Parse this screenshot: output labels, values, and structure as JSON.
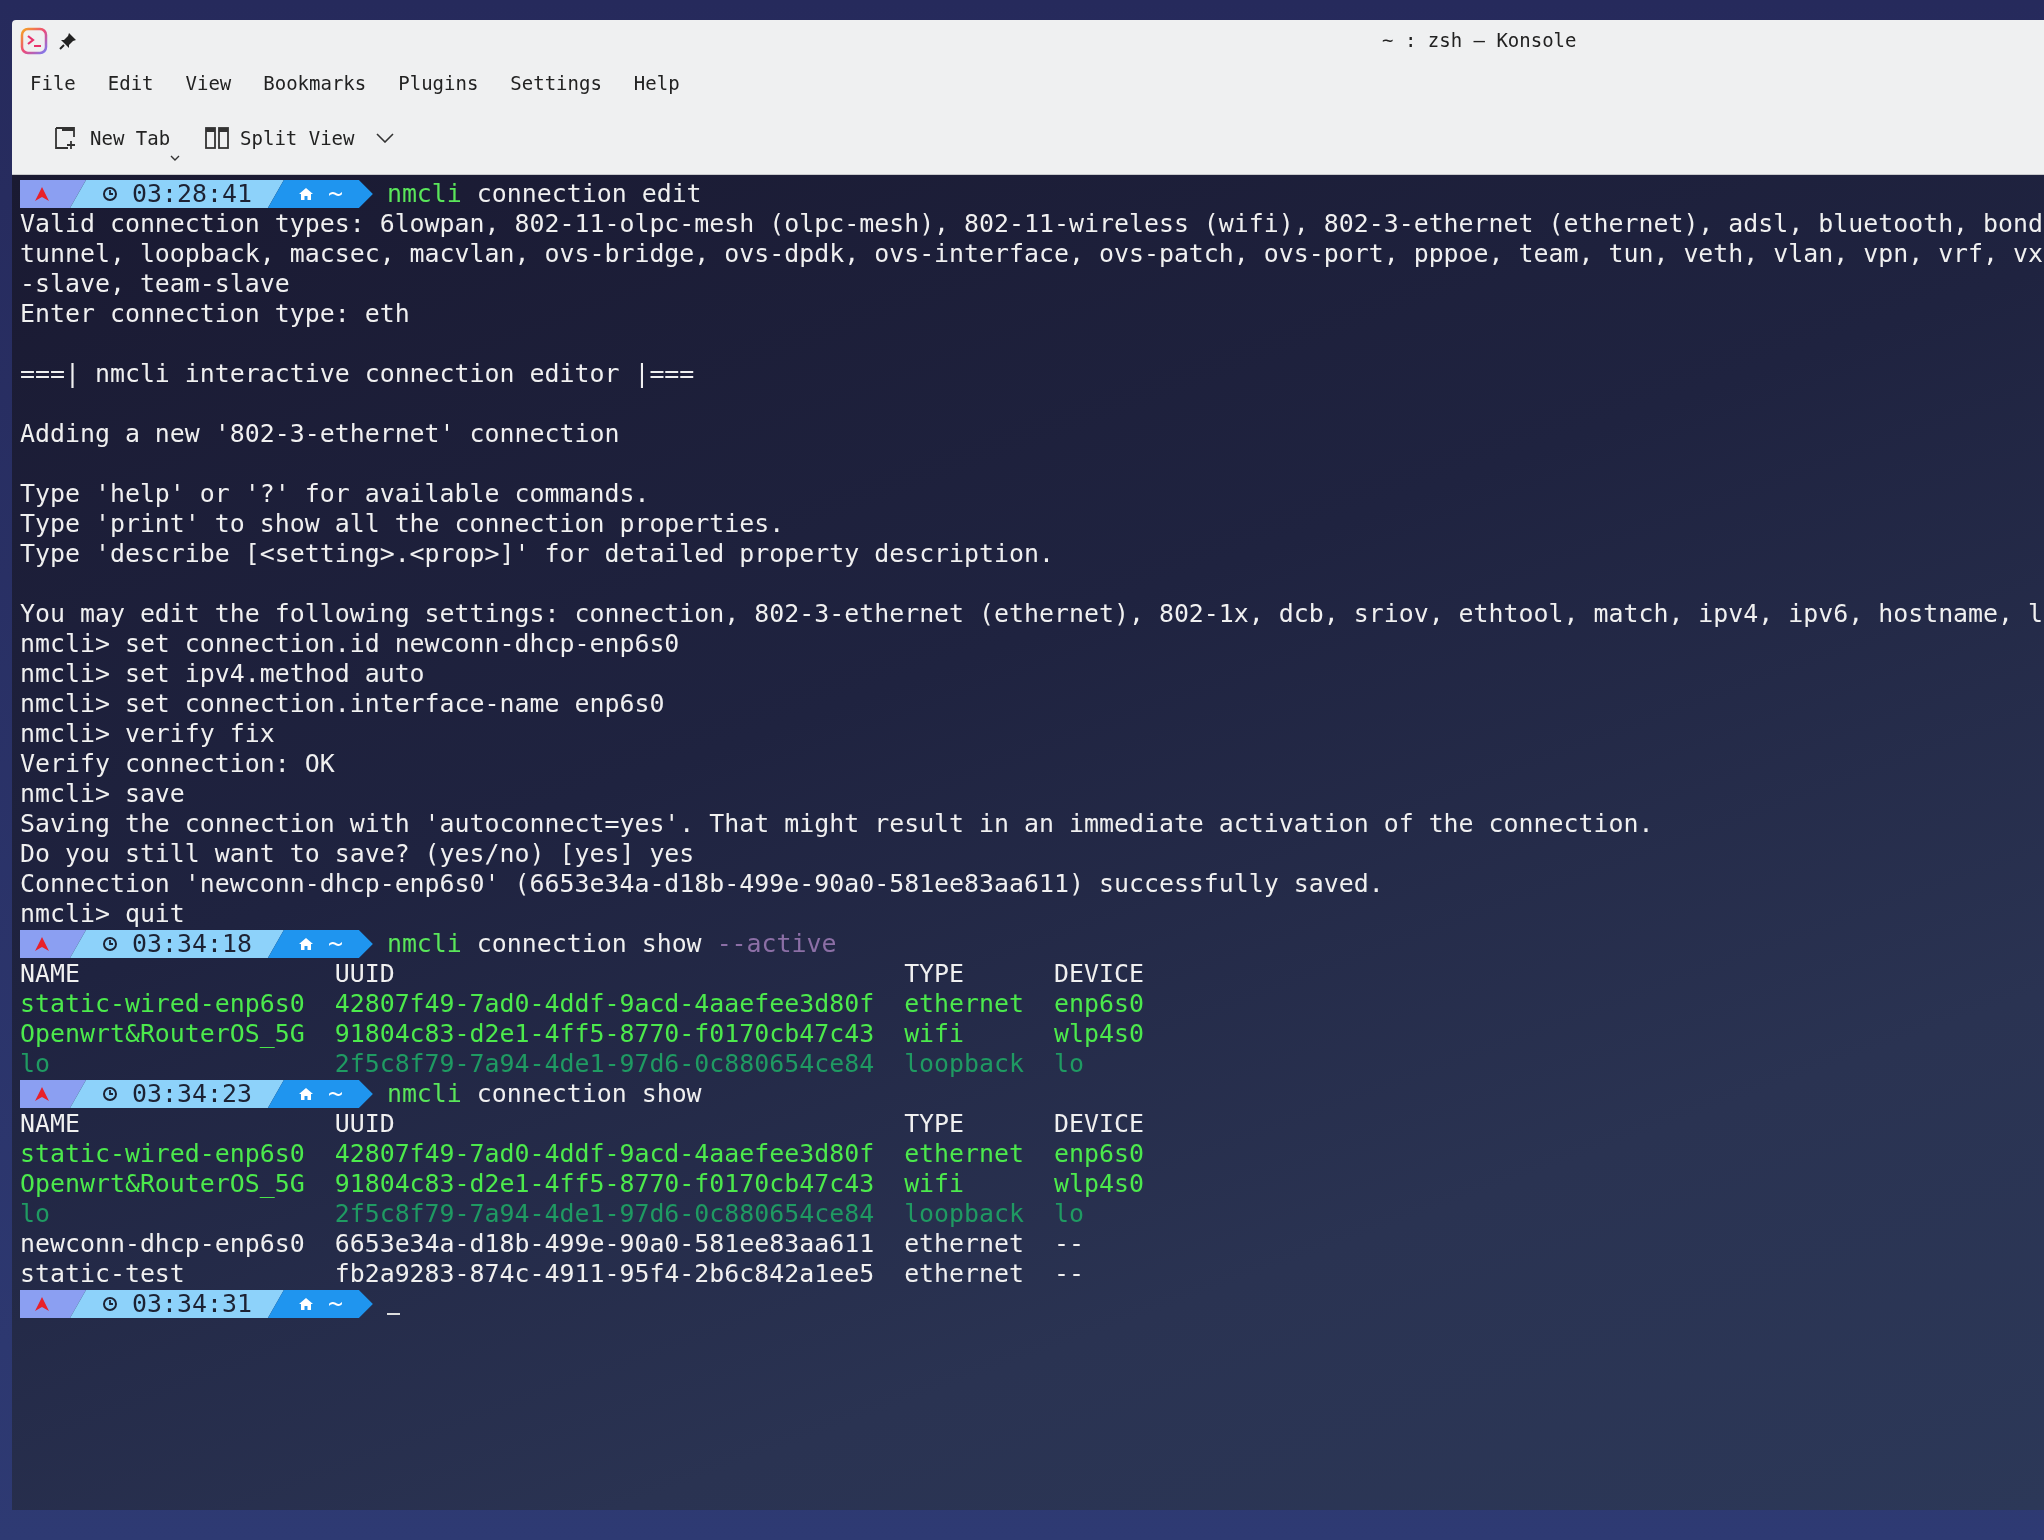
{
  "window": {
    "title": "~ : zsh — Konsole"
  },
  "menu": [
    "File",
    "Edit",
    "View",
    "Bookmarks",
    "Plugins",
    "Settings",
    "Help"
  ],
  "toolbar": [
    {
      "kind": "new_tab",
      "label": "New Tab"
    },
    {
      "kind": "split_view",
      "label": "Split View"
    }
  ],
  "terminal": {
    "lines": [
      {
        "kind": "prompt",
        "time": "03:28:41",
        "dir": "~",
        "command": "nmcli",
        "args": "connection edit"
      },
      {
        "kind": "output",
        "text": "Valid connection types: 6lowpan, 802-11-olpc-mesh (olpc-mesh), 802-11-wireless (wifi), 802-3-ethernet (ethernet), adsl, bluetooth, bond"
      },
      {
        "kind": "output",
        "text": "tunnel, loopback, macsec, macvlan, ovs-bridge, ovs-dpdk, ovs-interface, ovs-patch, ovs-port, pppoe, team, tun, veth, vlan, vpn, vrf, vx"
      },
      {
        "kind": "output",
        "text": "-slave, team-slave"
      },
      {
        "kind": "output",
        "text": "Enter connection type: eth"
      },
      {
        "kind": "blank"
      },
      {
        "kind": "output",
        "text": "===| nmcli interactive connection editor |==="
      },
      {
        "kind": "blank"
      },
      {
        "kind": "output",
        "text": "Adding a new '802-3-ethernet' connection"
      },
      {
        "kind": "blank"
      },
      {
        "kind": "output",
        "text": "Type 'help' or '?' for available commands."
      },
      {
        "kind": "output",
        "text": "Type 'print' to show all the connection properties."
      },
      {
        "kind": "output",
        "text": "Type 'describe [<setting>.<prop>]' for detailed property description."
      },
      {
        "kind": "blank"
      },
      {
        "kind": "output",
        "text": "You may edit the following settings: connection, 802-3-ethernet (ethernet), 802-1x, dcb, sriov, ethtool, match, ipv4, ipv6, hostname, l"
      },
      {
        "kind": "output",
        "text": "nmcli> set connection.id newconn-dhcp-enp6s0"
      },
      {
        "kind": "output",
        "text": "nmcli> set ipv4.method auto"
      },
      {
        "kind": "output",
        "text": "nmcli> set connection.interface-name enp6s0"
      },
      {
        "kind": "output",
        "text": "nmcli> verify fix"
      },
      {
        "kind": "output",
        "text": "Verify connection: OK"
      },
      {
        "kind": "output",
        "text": "nmcli> save"
      },
      {
        "kind": "output",
        "text": "Saving the connection with 'autoconnect=yes'. That might result in an immediate activation of the connection."
      },
      {
        "kind": "output",
        "text": "Do you still want to save? (yes/no) [yes] yes"
      },
      {
        "kind": "output",
        "text": "Connection 'newconn-dhcp-enp6s0' (6653e34a-d18b-499e-90a0-581ee83aa611) successfully saved."
      },
      {
        "kind": "output",
        "text": "nmcli> quit"
      },
      {
        "kind": "prompt",
        "time": "03:34:18",
        "dir": "~",
        "command": "nmcli",
        "args": "connection show",
        "flag": "--active"
      },
      {
        "kind": "table_header",
        "cells": [
          "NAME",
          "UUID",
          "TYPE",
          "DEVICE"
        ]
      },
      {
        "kind": "connected_row",
        "cells": [
          "static-wired-enp6s0",
          "42807f49-7ad0-4ddf-9acd-4aaefee3d80f",
          "ethernet",
          "enp6s0"
        ]
      },
      {
        "kind": "connected_row",
        "cells": [
          "Openwrt&RouterOS_5G",
          "91804c83-d2e1-4ff5-8770-f0170cb47c43",
          "wifi",
          "wlp4s0"
        ]
      },
      {
        "kind": "loopback_row",
        "cells": [
          "lo",
          "2f5c8f79-7a94-4de1-97d6-0c880654ce84",
          "loopback",
          "lo"
        ]
      },
      {
        "kind": "prompt",
        "time": "03:34:23",
        "dir": "~",
        "command": "nmcli",
        "args": "connection show"
      },
      {
        "kind": "table_header",
        "cells": [
          "NAME",
          "UUID",
          "TYPE",
          "DEVICE"
        ]
      },
      {
        "kind": "connected_row",
        "cells": [
          "static-wired-enp6s0",
          "42807f49-7ad0-4ddf-9acd-4aaefee3d80f",
          "ethernet",
          "enp6s0"
        ]
      },
      {
        "kind": "connected_row",
        "cells": [
          "Openwrt&RouterOS_5G",
          "91804c83-d2e1-4ff5-8770-f0170cb47c43",
          "wifi",
          "wlp4s0"
        ]
      },
      {
        "kind": "loopback_row",
        "cells": [
          "lo",
          "2f5c8f79-7a94-4de1-97d6-0c880654ce84",
          "loopback",
          "lo"
        ]
      },
      {
        "kind": "plain_row",
        "cells": [
          "newconn-dhcp-enp6s0",
          "6653e34a-d18b-499e-90a0-581ee83aa611",
          "ethernet",
          "--"
        ]
      },
      {
        "kind": "plain_row",
        "cells": [
          "static-test",
          "fb2a9283-874c-4911-95f4-2b6c842a1ee5",
          "ethernet",
          "--"
        ]
      },
      {
        "kind": "prompt",
        "time": "03:34:31",
        "dir": "~",
        "cursor": true
      }
    ]
  }
}
